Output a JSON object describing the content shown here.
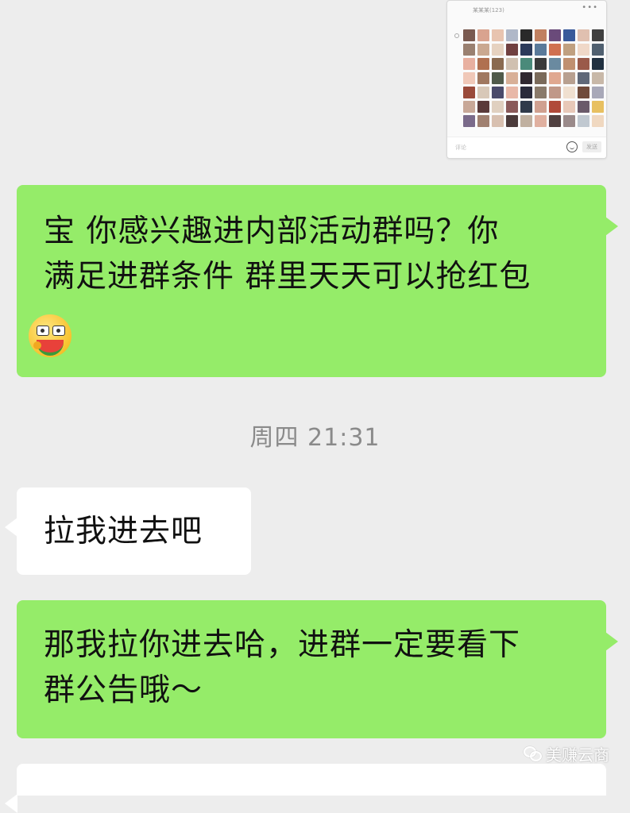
{
  "image_message": {
    "header_text": "某某某(123)",
    "placeholder": "评论",
    "send_label": "发送",
    "more_icon": "more-dots-icon",
    "emoji_icon": "smiley-icon",
    "avatar_colors": [
      "#7a5a50",
      "#d9a38f",
      "#e8c4b0",
      "#b0b8c8",
      "#2a2a2a",
      "#c08060",
      "#6a4a7a",
      "#3a5a9a",
      "#e0c0b0",
      "#404040",
      "#9a8070",
      "#caa890",
      "#e6d2c0",
      "#704040",
      "#2b3a5a",
      "#5a7a9a",
      "#d07050",
      "#c0a080",
      "#f0d8c8",
      "#506070",
      "#e8b0a0",
      "#b07050",
      "#8a6a50",
      "#d0c0b0",
      "#4a8a7a",
      "#3a3a3a",
      "#6a8aa0",
      "#c09070",
      "#9a5a4a",
      "#203040",
      "#f0c8b8",
      "#a07860",
      "#505a4a",
      "#d8b098",
      "#302830",
      "#7a6a5a",
      "#e0a890",
      "#b8a090",
      "#606878",
      "#c8b8a8",
      "#9a4a3a",
      "#d8c8b8",
      "#4a4a6a",
      "#e8b8a8",
      "#2a2a3a",
      "#8a7a6a",
      "#c09888",
      "#f0e0d0",
      "#704a3a",
      "#a8a8b8",
      "#c8a898",
      "#5a3a3a",
      "#e0d0c0",
      "#8a5a5a",
      "#303a4a",
      "#d0a090",
      "#b04a3a",
      "#e8c8b8",
      "#6a5a6a",
      "#e8c060",
      "#7a6a8a",
      "#a08070",
      "#d8c0b0",
      "#4a3a3a",
      "#c0b0a0",
      "#e0b0a0",
      "#504040",
      "#9a8a8a",
      "#c0c8d0",
      "#f0d8c0"
    ],
    "avatar_alts": [
      "user-avatar",
      "user-avatar",
      "user-avatar",
      "user-avatar",
      "user-avatar",
      "user-avatar",
      "user-avatar",
      "user-avatar",
      "user-avatar",
      "user-avatar",
      "user-avatar",
      "user-avatar",
      "user-avatar",
      "user-avatar",
      "user-avatar",
      "user-avatar",
      "user-avatar",
      "user-avatar",
      "user-avatar",
      "user-avatar",
      "user-avatar",
      "user-avatar",
      "user-avatar",
      "user-avatar",
      "user-avatar",
      "user-avatar",
      "user-avatar",
      "user-avatar",
      "user-avatar",
      "user-avatar",
      "user-avatar",
      "user-avatar",
      "user-avatar",
      "user-avatar",
      "user-avatar",
      "user-avatar",
      "user-avatar",
      "user-avatar",
      "user-avatar",
      "user-avatar",
      "user-avatar",
      "user-avatar",
      "user-avatar",
      "user-avatar",
      "user-avatar",
      "user-avatar",
      "user-avatar",
      "user-avatar",
      "user-avatar",
      "user-avatar",
      "user-avatar",
      "user-avatar",
      "user-avatar",
      "user-avatar",
      "user-avatar",
      "user-avatar",
      "user-avatar",
      "user-avatar",
      "user-avatar",
      "user-avatar",
      "user-avatar",
      "user-avatar",
      "user-avatar",
      "user-avatar",
      "user-avatar",
      "user-avatar",
      "user-avatar",
      "user-avatar",
      "user-avatar",
      "user-avatar"
    ]
  },
  "messages": [
    {
      "from": "self",
      "line1": "宝 你感兴趣进内部活动群吗？你",
      "line2": "满足进群条件 群里天天可以抢红包",
      "emoji": "watermelon-face-emoji"
    },
    {
      "from": "other",
      "text": "拉我进去吧"
    },
    {
      "from": "self",
      "line1": "那我拉你进去哈，进群一定要看下",
      "line2": "群公告哦～"
    }
  ],
  "timestamp": "周四 21:31",
  "watermark": {
    "text": "美赚云商",
    "icon": "wechat-channel-icon"
  },
  "colors": {
    "background": "#ededed",
    "self_bubble": "#95ec69",
    "other_bubble": "#ffffff",
    "timestamp": "#8a8a8a"
  }
}
